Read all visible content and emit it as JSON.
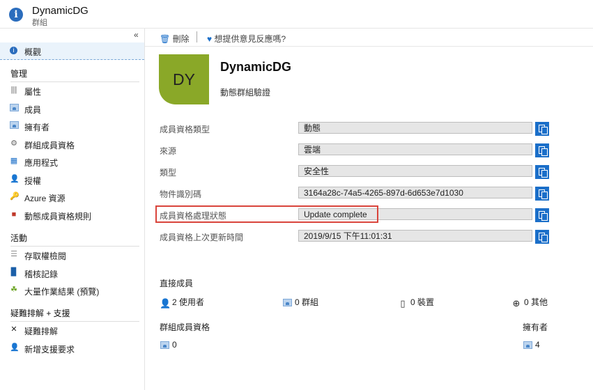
{
  "header": {
    "title": "DynamicDG",
    "subtitle": "群組"
  },
  "sidebar": {
    "collapse": "«",
    "overview": "概觀",
    "sections": {
      "manage": "管理",
      "activity": "活動",
      "troubleshoot": "疑難排解 + 支援"
    },
    "manage_items": [
      {
        "label": "屬性"
      },
      {
        "label": "成員"
      },
      {
        "label": "擁有者"
      },
      {
        "label": "群組成員資格"
      },
      {
        "label": "應用程式"
      },
      {
        "label": "授權"
      },
      {
        "label": "Azure 資源"
      },
      {
        "label": "動態成員資格規則"
      }
    ],
    "activity_items": [
      {
        "label": "存取權檢閱"
      },
      {
        "label": "稽核記錄"
      },
      {
        "label": "大量作業結果 (預覽)"
      }
    ],
    "support_items": [
      {
        "label": "疑難排解"
      },
      {
        "label": "新增支援要求"
      }
    ]
  },
  "toolbar": {
    "delete_label": "刪除",
    "feedback_label": "想提供意見反應嗎?"
  },
  "group": {
    "initials": "DY",
    "name": "DynamicDG",
    "description": "動態群組驗證"
  },
  "properties": [
    {
      "label": "成員資格類型",
      "value": "動態"
    },
    {
      "label": "來源",
      "value": "雲端"
    },
    {
      "label": "類型",
      "value": "安全性"
    },
    {
      "label": "物件識別碼",
      "value": "3164a28c-74a5-4265-897d-6d653e7d1030"
    },
    {
      "label": "成員資格處理狀態",
      "value": "Update complete"
    },
    {
      "label": "成員資格上次更新時間",
      "value": "2019/9/15 下午11:01:31"
    }
  ],
  "direct_members": {
    "title": "直接成員",
    "users": "2 使用者",
    "groups": "0 群組",
    "devices": "0 裝置",
    "others": "0 其他"
  },
  "group_memberships": {
    "title": "群組成員資格",
    "count": "0"
  },
  "owners": {
    "title": "擁有者",
    "count": "4"
  },
  "colors": {
    "accent": "#1b6fc9",
    "avatar": "#8aa828",
    "highlight": "#d9443b"
  }
}
